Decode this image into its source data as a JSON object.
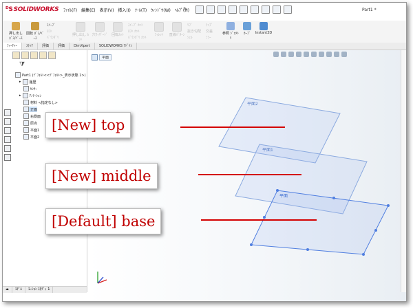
{
  "app": {
    "logo_text": "SOLIDWORKS",
    "document_title": "Part1 *",
    "menus": [
      "ﾌｧｲﾙ(F)",
      "編集(E)",
      "表示(V)",
      "挿入(I)",
      "ﾂｰﾙ(T)",
      "ｳｨﾝﾄﾞｳ(W)",
      "ﾍﾙﾌﾟ(H)"
    ]
  },
  "commands": {
    "extrude_boss": "押し出し ﾎﾞｽ/ﾍﾞｰｽ",
    "revolve_boss": "回転 ﾎﾞｽ/ﾍﾞｰｽ",
    "sweep": "ｽｲｰﾌﾟ",
    "loft": "ﾛﾌﾄ",
    "boundary": "ﾊﾞｳﾝﾀﾞﾘ",
    "extrude_cut": "押し出し ｶｯﾄ",
    "hole_wizard": "穴ｳｨｻﾞｰﾄﾞ",
    "revolve_cut": "回転ｶｯﾄ",
    "sweep_cut": "ｽｲｰﾌﾟ ｶｯﾄ",
    "loft_cut": "ﾛﾌﾄ ｶｯﾄ",
    "boundary_cut": "ﾊﾞｳﾝﾀﾞﾘ ｶｯﾄ",
    "fillet": "ﾌｨﾚｯﾄ",
    "linear_pattern": "直線ﾊﾟﾀｰﾝ",
    "rib": "ﾘﾌﾞ",
    "draft": "抜き勾配",
    "shell": "ｼｪﾙ",
    "wrap": "ﾗｯﾌﾟ",
    "intersect": "交差",
    "mirror": "ﾐﾗｰ",
    "reference_geometry": "参照 ｼﾞｵﾒﾄﾘ",
    "curves": "ｶｰﾌﾞ",
    "instant3d": "Instant3D"
  },
  "tabs": [
    "ﾌｨｰﾁｬｰ",
    "ｽｹｯﾁ",
    "評価",
    "評価",
    "DimXpert",
    "SOLIDWORKS ｱﾄﾞｲﾝ"
  ],
  "tree": {
    "root": "Part1 (ﾃﾞﾌｫﾙﾄ<<ﾃﾞﾌｫﾙﾄ>_表示状態 1>)",
    "items": [
      "履歴",
      "ｾﾝｻｰ",
      "ｱﾉﾃｰｼｮﾝ",
      "材料 <指定なし>",
      "正面",
      "右側面",
      "原点",
      "平面1",
      "平面2"
    ]
  },
  "bottom_tabs": [
    "ﾓﾃﾞﾙ",
    "ﾓｰｼｮﾝ ｽﾀﾃﾞｨ 1"
  ],
  "breadcrumb": "平面",
  "planes": [
    "平面2",
    "平面1",
    "平面"
  ],
  "callouts": {
    "top": "[New] top",
    "middle": "[New] middle",
    "base": "[Default] base"
  },
  "colors": {
    "accent_red": "#d40000",
    "plane_blue": "#6f95d8",
    "logo_red": "#c8102e"
  }
}
